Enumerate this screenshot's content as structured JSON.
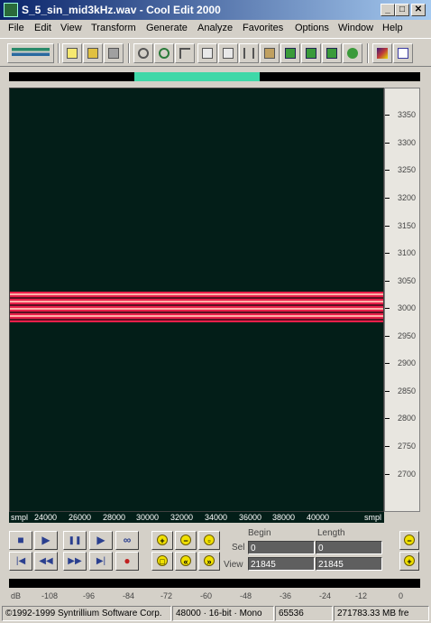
{
  "window": {
    "title": "S_5_sin_mid3kHz.wav - Cool Edit 2000",
    "minimize": "_",
    "maximize": "□",
    "close": "✕"
  },
  "menu": [
    "File",
    "Edit",
    "View",
    "Transform",
    "Generate",
    "Analyze",
    "Favorites",
    "Options",
    "Window",
    "Help"
  ],
  "toolbar_icons": [
    "multitrack-toggle-icon",
    "new-icon",
    "open-icon",
    "save-icon",
    "undo-icon",
    "repeat-icon",
    "mix-paste-icon",
    "copy-new-icon",
    "copy-icon",
    "cut-icon",
    "paste-icon",
    "paste-new-icon",
    "spectral-view-icon",
    "waveform-view-icon",
    "cd-player-icon",
    "spectrum-icon",
    "settings-icon"
  ],
  "colors": {
    "spectrogram_bg": "#031e18",
    "band_red": "#e8204a",
    "band_pink": "#ffb0a8",
    "overview_visible": "#3fd8a8"
  },
  "frequency_axis": {
    "ticks": [
      "3350",
      "3300",
      "3250",
      "3200",
      "3150",
      "3100",
      "3050",
      "3000",
      "2950",
      "2900",
      "2850",
      "2800",
      "2750",
      "2700"
    ]
  },
  "sample_axis": {
    "unit_left": "smpl",
    "unit_right": "smpl",
    "ticks": [
      "24000",
      "26000",
      "28000",
      "30000",
      "32000",
      "34000",
      "36000",
      "38000",
      "40000"
    ]
  },
  "transport": {
    "stop": "■",
    "play": "▶",
    "pause": "❚❚",
    "play_to_end": "▶",
    "loop": "∞",
    "go_start": "|◀",
    "rewind": "◀◀",
    "fast_forward": "▶▶",
    "go_end": "▶|",
    "record": "●"
  },
  "zoom_labels": {
    "zoom_in_h": "+",
    "zoom_out_h": "−",
    "zoom_full": "▫",
    "zoom_sel": "□",
    "zoom_left": "«",
    "zoom_right": "»",
    "zoom_out_v": "−",
    "zoom_in_v": "+"
  },
  "selection": {
    "begin_header": "Begin",
    "length_header": "Length",
    "sel_label": "Sel",
    "view_label": "View",
    "sel_begin": "0",
    "sel_length": "0",
    "view_begin": "21845",
    "view_length": "21845"
  },
  "level_meter": {
    "ticks": [
      "dB",
      "-108",
      "-96",
      "-84",
      "-72",
      "-60",
      "-48",
      "-36",
      "-24",
      "-12",
      "0"
    ]
  },
  "status": {
    "copyright": "©1992-1999 Syntrillium Software Corp.",
    "format": "48000 · 16-bit · Mono",
    "size": "65536",
    "free": "271783.33 MB fre"
  }
}
